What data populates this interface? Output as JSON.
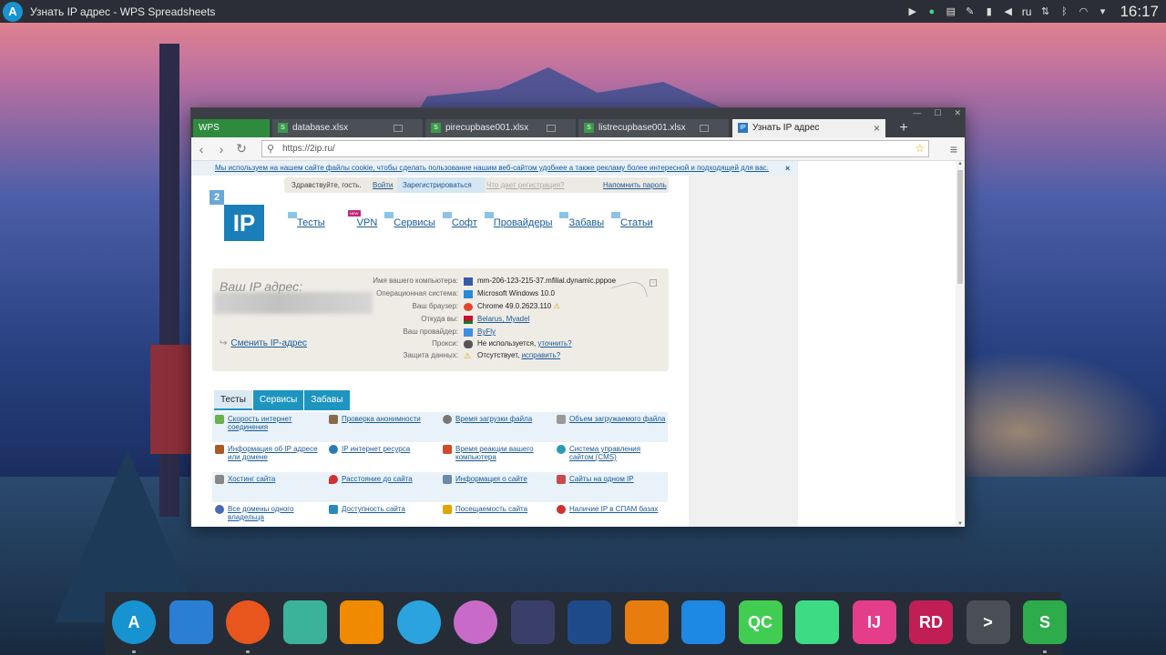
{
  "topbar": {
    "window_title": "Узнать IP адрес - WPS Spreadsheets",
    "lang": "ru",
    "clock": "16:17"
  },
  "browser": {
    "app_tab": "WPS Spreadsheets",
    "tabs": [
      {
        "label": "database.xlsx"
      },
      {
        "label": "pirecupbase001.xlsx"
      },
      {
        "label": "listrecupbase001.xlsx"
      },
      {
        "label": "Узнать IP адрес"
      }
    ],
    "new_tab": "+",
    "url": "https://2ip.ru/"
  },
  "page": {
    "cookie_notice": "Мы используем на нашем сайте файлы cookie, чтобы сделать пользование нашим веб-сайтом удобнее а также рекламу более интересной и подходящей для вас.",
    "cookie_close": "×",
    "greet": {
      "hello": "Здравствуйте, гость.",
      "login": "Войти",
      "register": "Зарегистрироваться",
      "why": "Что дает регистрация?",
      "remind": "Напомнить пароль"
    },
    "logo": {
      "small": "2",
      "big": "IP"
    },
    "nav": [
      "Тесты",
      "VPN",
      "Сервисы",
      "Софт",
      "Провайдеры",
      "Забавы",
      "Статьи"
    ],
    "nav_new": "NEW",
    "ip_block": {
      "title": "Ваш IP адрес:",
      "change": "Сменить IP-адрес",
      "rows": [
        {
          "label": "Имя вашего компьютера:",
          "value": "mm-206-123-215-37.mfilial.dynamic.pppoe"
        },
        {
          "label": "Операционная система:",
          "value": "Microsoft Windows 10.0"
        },
        {
          "label": "Ваш браузер:",
          "value": "Chrome 49.0.2623.110"
        },
        {
          "label": "Откуда вы:",
          "value": "Belarus, Myadel"
        },
        {
          "label": "Ваш провайдер:",
          "value": "ByFly"
        },
        {
          "label": "Прокси:",
          "value": "Не используется,",
          "link": "уточнить?"
        },
        {
          "label": "Защита данных:",
          "value": "Отсутствует,",
          "link": "исправить?"
        }
      ]
    },
    "subtabs": [
      "Тесты",
      "Сервисы",
      "Забавы"
    ],
    "grid": [
      [
        "Скорость интернет соединения",
        "Проверка анонимности",
        "Время загрузки файла",
        "Объем загружаемого файла"
      ],
      [
        "Информация об IP адресе или домене",
        "IP интернет ресурса",
        "Время реакции вашего компьютера",
        "Система управления сайтом (CMS)"
      ],
      [
        "Хостинг сайта",
        "Расстояние до сайта",
        "Информация о сайте",
        "Сайты на одном IP"
      ],
      [
        "Все домены одного владельца",
        "Доступность сайта",
        "Посещаемость сайта",
        "Наличие IP в СПАМ базах"
      ]
    ]
  },
  "dock": {
    "items": [
      {
        "icon": "arch-linux-icon",
        "color": "#1793d1",
        "glyph": "A"
      },
      {
        "icon": "file-manager-icon",
        "color": "#2a7fd4",
        "glyph": ""
      },
      {
        "icon": "firefox-icon",
        "color": "#e8561e",
        "glyph": ""
      },
      {
        "icon": "cassette-icon",
        "color": "#3bb39a",
        "glyph": ""
      },
      {
        "icon": "vlc-icon",
        "color": "#f08a00",
        "glyph": ""
      },
      {
        "icon": "telegram-icon",
        "color": "#2aa3df",
        "glyph": ""
      },
      {
        "icon": "paint-icon",
        "color": "#c86bc8",
        "glyph": ""
      },
      {
        "icon": "kdenlive-icon",
        "color": "#3a3f6a",
        "glyph": ""
      },
      {
        "icon": "audio-icon",
        "color": "#1e4a8a",
        "glyph": ""
      },
      {
        "icon": "blender-icon",
        "color": "#e87d0d",
        "glyph": ""
      },
      {
        "icon": "vscode-icon",
        "color": "#1e88e5",
        "glyph": ""
      },
      {
        "icon": "qtcreator-icon",
        "color": "#41cd52",
        "glyph": "QC"
      },
      {
        "icon": "android-studio-icon",
        "color": "#3ddc84",
        "glyph": ""
      },
      {
        "icon": "intellij-icon",
        "color": "#e43d8a",
        "glyph": "IJ"
      },
      {
        "icon": "rider-icon",
        "color": "#c21e56",
        "glyph": "RD"
      },
      {
        "icon": "terminal-icon",
        "color": "#4a4e55",
        "glyph": ">"
      },
      {
        "icon": "wps-spreadsheets-icon",
        "color": "#2eab4a",
        "glyph": "S"
      }
    ]
  }
}
